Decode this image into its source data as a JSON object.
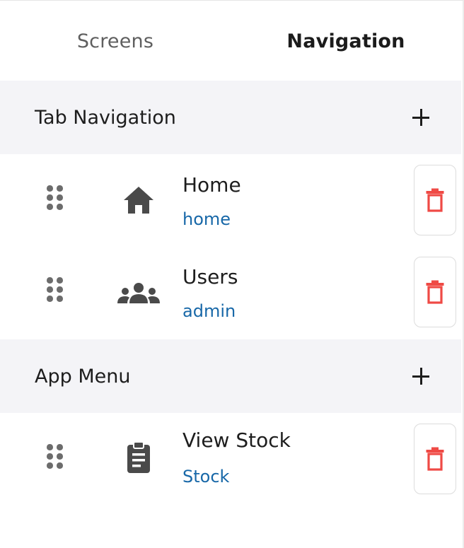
{
  "tabs": [
    {
      "label": "Screens",
      "active": false
    },
    {
      "label": "Navigation",
      "active": true
    }
  ],
  "sections": [
    {
      "title": "Tab Navigation",
      "add_icon": "plus-icon",
      "items": [
        {
          "name": "Home",
          "route": "home",
          "icon": "home-icon"
        },
        {
          "name": "Users",
          "route": "admin",
          "icon": "users-group-icon"
        }
      ]
    },
    {
      "title": "App Menu",
      "add_icon": "plus-icon",
      "items": [
        {
          "name": "View Stock",
          "route": "Stock",
          "icon": "clipboard-list-icon"
        }
      ]
    }
  ],
  "colors": {
    "section_background": "#f4f4f7",
    "route_text": "#1868a8",
    "delete_icon": "#ef4a45",
    "item_icon": "#4a4a4a",
    "drag_handle": "#6c6c6c"
  }
}
